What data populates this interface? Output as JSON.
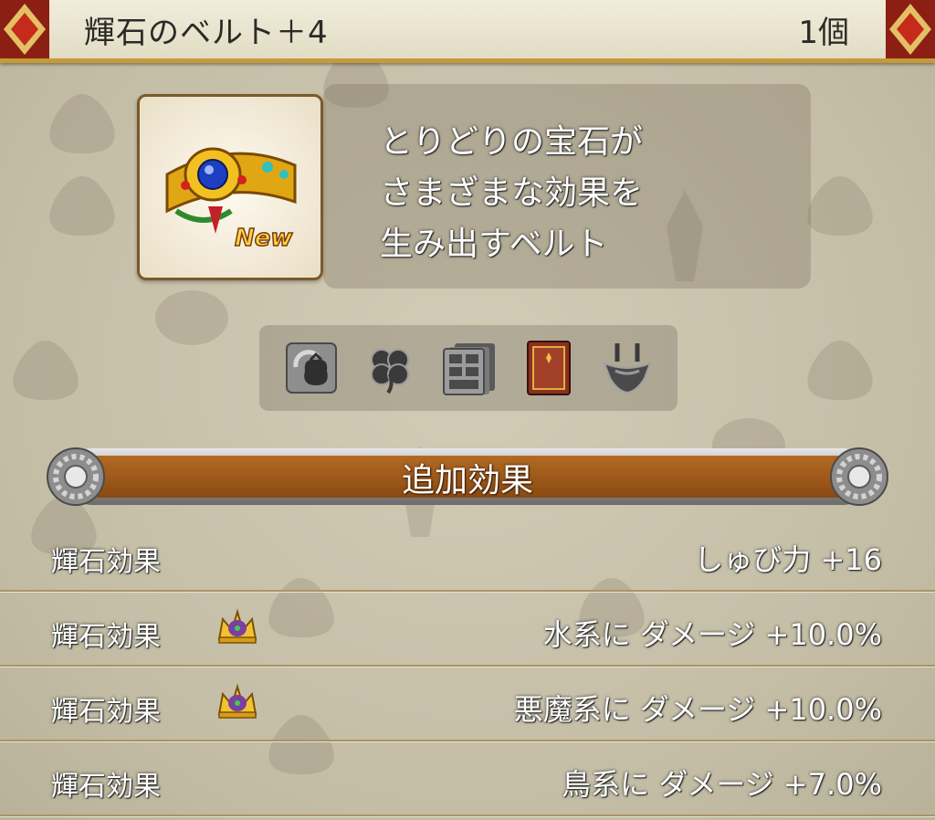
{
  "header": {
    "title": "輝石のベルト＋4",
    "count": "1個"
  },
  "item": {
    "icon": "belt-icon",
    "badge": "New",
    "description_lines": [
      "とりどりの宝石が",
      "さまざまな効果を",
      "生み出すベルト"
    ]
  },
  "category_icons": [
    "bag-cycle-icon",
    "clover-icon",
    "drawer-stack-icon",
    "book-icon",
    "armor-icon"
  ],
  "section": {
    "label": "追加効果"
  },
  "effects": [
    {
      "label": "輝石効果",
      "value": "しゅび力 +16",
      "crown": false
    },
    {
      "label": "輝石効果",
      "value": "水系に ダメージ +10.0%",
      "crown": true
    },
    {
      "label": "輝石効果",
      "value": "悪魔系に ダメージ +10.0%",
      "crown": true
    },
    {
      "label": "輝石効果",
      "value": "鳥系に ダメージ +7.0%",
      "crown": false
    }
  ],
  "colors": {
    "header_gold": "#c59a37",
    "section_bar": "#8a4a12",
    "text": "#ffffff"
  }
}
